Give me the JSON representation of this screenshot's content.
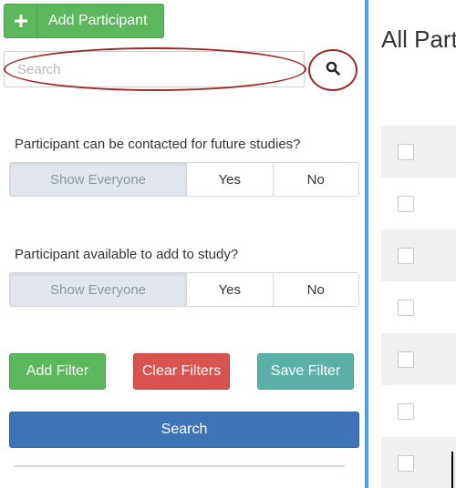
{
  "sidebar": {
    "add_participant_label": "Add Participant",
    "search_placeholder": "Search",
    "search_value": "",
    "filters": [
      {
        "question": "Participant can be contacted for future studies?",
        "options": [
          "Show Everyone",
          "Yes",
          "No"
        ],
        "selected": "Show Everyone"
      },
      {
        "question": "Participant available to add to study?",
        "options": [
          "Show Everyone",
          "Yes",
          "No"
        ],
        "selected": "Show Everyone"
      }
    ],
    "buttons": {
      "add_filter": "Add Filter",
      "clear_filters": "Clear Filters",
      "save_filter": "Save Filter",
      "search": "Search"
    }
  },
  "main": {
    "title": "All Part"
  },
  "icons": {
    "add": "plus-icon",
    "search": "search-icon"
  },
  "colors": {
    "success": "#5cb85c",
    "danger": "#d9534f",
    "teal": "#5bb0a7",
    "primary": "#3e74b5",
    "annotation": "#a0282a",
    "separator": "#4aa3e8"
  }
}
